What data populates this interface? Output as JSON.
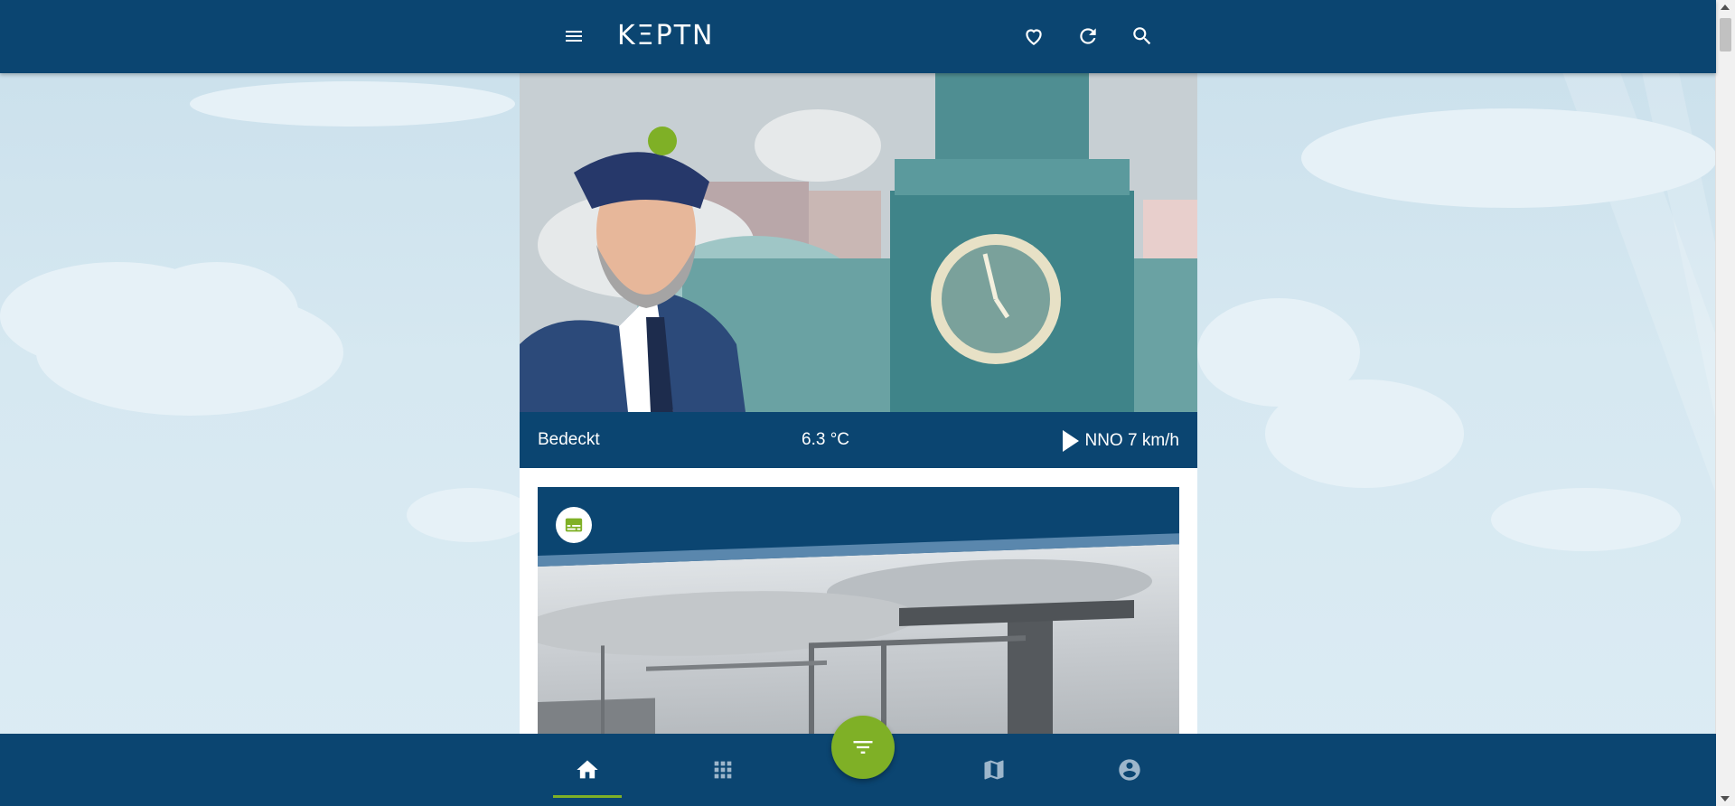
{
  "app": {
    "logo_text": "KΞPTN"
  },
  "colors": {
    "primary": "#0b4571",
    "accent": "#7fb026",
    "sky": "#d3e6f0"
  },
  "header": {
    "menu_icon": "menu-icon",
    "favorites_icon": "heart-icon",
    "refresh_icon": "refresh-icon",
    "search_icon": "search-icon"
  },
  "weather": {
    "condition": "Bedeckt",
    "temperature": "6.3 °C",
    "wind": "NNO 7 km/h"
  },
  "card": {
    "badge_icon": "subtitles-icon"
  },
  "bottom_nav": {
    "items": [
      {
        "name": "home",
        "icon": "home-icon",
        "active": true
      },
      {
        "name": "apps",
        "icon": "grid-icon",
        "active": false
      },
      {
        "name": "map",
        "icon": "map-icon",
        "active": false
      },
      {
        "name": "account",
        "icon": "account-circle-icon",
        "active": false
      }
    ],
    "fab_icon": "filter-icon"
  }
}
